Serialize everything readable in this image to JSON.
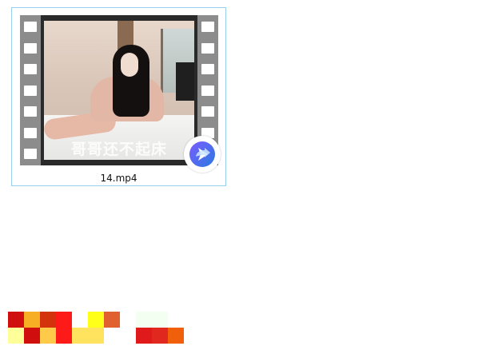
{
  "file": {
    "name": "14.mp4",
    "thumbnail_caption": "哥哥还不起床",
    "badge_icon": "share-arrow-icon"
  },
  "colors": {
    "selection_border": "#99d1ec",
    "film_dark": "#2a2a2a",
    "film_strip": "#8c8c8c",
    "badge_blue": "#2b7ae0",
    "badge_purple": "#7a5cff"
  },
  "mosaic_colors": [
    "#d10e0e",
    "#f7ae24",
    "#d4320a",
    "#ff1a1a",
    "#ffffff",
    "#ffff1a",
    "#e06030",
    "#ffffff",
    "#f3fff0",
    "#f3fff0",
    "#ffffff",
    "#ffff99",
    "#d10e0e",
    "#ffc94a",
    "#ff1a1a",
    "#ffe35e",
    "#ffe35e",
    "#ffffff",
    "#ffffff",
    "#e01a1a",
    "#e0281e",
    "#f0600a"
  ]
}
